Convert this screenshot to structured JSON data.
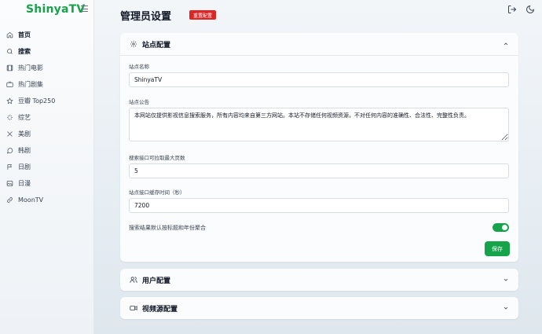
{
  "sidebar": {
    "brand": "ShinyaTV",
    "items": [
      {
        "label": "首页",
        "icon": "home-icon"
      },
      {
        "label": "搜索",
        "icon": "search-icon"
      },
      {
        "label": "热门电影",
        "icon": "film-icon"
      },
      {
        "label": "热门剧集",
        "icon": "tv-icon"
      },
      {
        "label": "豆瓣 Top250",
        "icon": "star-icon"
      },
      {
        "label": "综艺",
        "icon": "sparkles-icon"
      },
      {
        "label": "美剧",
        "icon": "cross-swords-icon"
      },
      {
        "label": "韩剧",
        "icon": "chat-icon"
      },
      {
        "label": "日剧",
        "icon": "flag-icon"
      },
      {
        "label": "日漫",
        "icon": "image-icon"
      },
      {
        "label": "MoonTV",
        "icon": "link-icon"
      }
    ]
  },
  "header": {
    "title": "管理员设置",
    "reset_label": "重置配置"
  },
  "site_config": {
    "title": "站点配置",
    "site_name_label": "站点名称",
    "site_name_value": "ShinyaTV",
    "announcement_label": "站点公告",
    "announcement_value": "本网站仅提供影视信息搜索服务，所有内容均来自第三方网站。本站不存储任何视频资源，不对任何内容的准确性、合法性、完整性负责。",
    "max_pages_label": "搜索接口可拉取最大页数",
    "max_pages_value": "5",
    "cache_time_label": "站点接口缓存时间（秒）",
    "cache_time_value": "7200",
    "aggregate_label": "搜索结果默认按标题和年份聚合",
    "aggregate_on": true,
    "save_label": "保存"
  },
  "user_config": {
    "title": "用户配置"
  },
  "source_config": {
    "title": "视频源配置"
  },
  "colors": {
    "accent": "#16a34a",
    "danger": "#dc2626"
  }
}
